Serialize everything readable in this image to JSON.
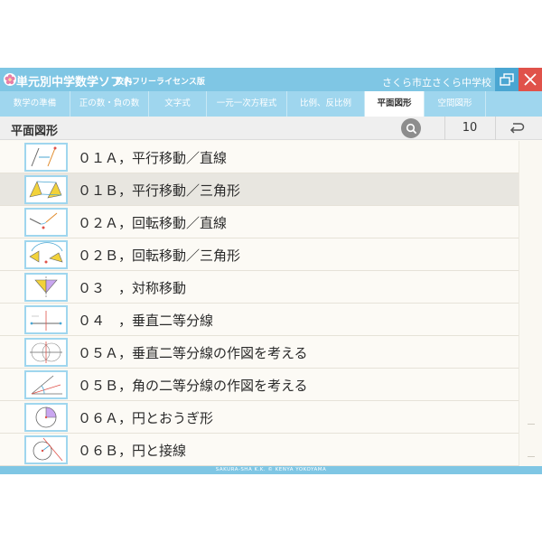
{
  "app": {
    "title": "単元別中学数学ソフト",
    "edition": "校内フリーライセンス版",
    "school": "さくら市立さくら中学校",
    "colors": {
      "titlebar": "#7fc6e4",
      "tabbar": "#9fd6ee",
      "close": "#e0524a",
      "restore": "#4aa6d2"
    }
  },
  "tabs": [
    {
      "label": "数学の準備",
      "active": false
    },
    {
      "label": "正の数・負の数",
      "active": false
    },
    {
      "label": "文字式",
      "active": false
    },
    {
      "label": "一元一次方程式",
      "active": false
    },
    {
      "label": "比例、反比例",
      "active": false
    },
    {
      "label": "平面図形",
      "active": true
    },
    {
      "label": "空間図形",
      "active": false
    }
  ],
  "header": {
    "section_title": "平面図形",
    "count": "10",
    "search_icon": "search-icon",
    "back_icon": "return-arrow-icon"
  },
  "lessons": [
    {
      "label": "０１Ａ，平行移動／直線",
      "thumb": "parallel-line"
    },
    {
      "label": "０１Ｂ，平行移動／三角形",
      "thumb": "parallel-triangle",
      "selected": true
    },
    {
      "label": "０２Ａ，回転移動／直線",
      "thumb": "rotation-line"
    },
    {
      "label": "０２Ｂ，回転移動／三角形",
      "thumb": "rotation-triangle"
    },
    {
      "label": "０３　，対称移動",
      "thumb": "symmetry"
    },
    {
      "label": "０４　，垂直二等分線",
      "thumb": "bisector"
    },
    {
      "label": "０５Ａ，垂直二等分線の作図を考える",
      "thumb": "bisector-construction"
    },
    {
      "label": "０５Ｂ，角の二等分線の作図を考える",
      "thumb": "angle-bisector"
    },
    {
      "label": "０６Ａ，円とおうぎ形",
      "thumb": "circle-sector"
    },
    {
      "label": "０６Ｂ，円と接線",
      "thumb": "circle-tangent"
    }
  ],
  "footer": {
    "copyright": "SAKURA-SHA K.K.  © KENYA YOKOYAMA"
  }
}
